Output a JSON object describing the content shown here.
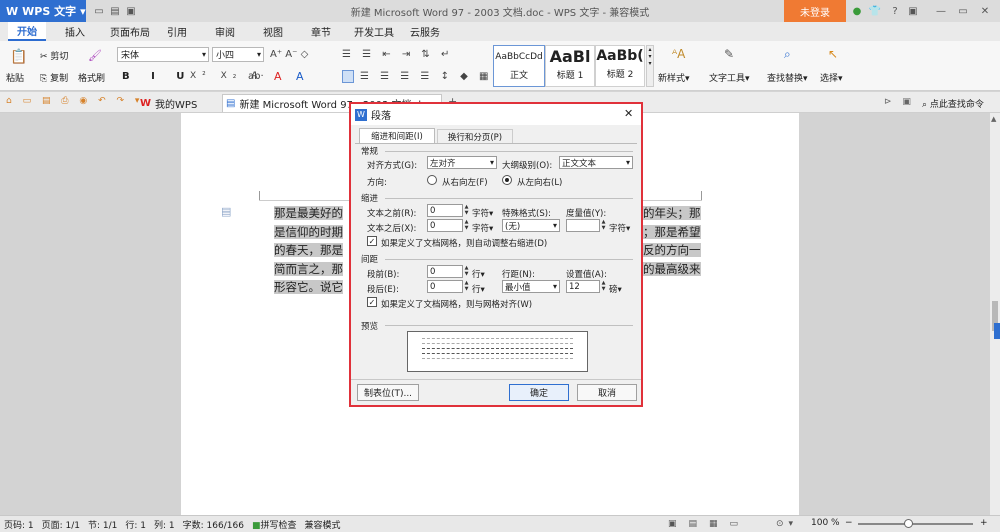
{
  "title_bar": {
    "app_name": "WPS 文字",
    "window_title": "新建 Microsoft Word 97 - 2003 文档.doc - WPS 文字 - 兼容模式",
    "login_label": "未登录"
  },
  "ribbon_tabs": [
    "开始",
    "插入",
    "页面布局",
    "引用",
    "审阅",
    "视图",
    "章节",
    "开发工具",
    "云服务"
  ],
  "ribbon": {
    "paste": "粘贴",
    "cut": "剪切",
    "copy": "复制",
    "format_painter": "格式刷",
    "font_name": "宋体",
    "font_size": "小四",
    "styles": [
      {
        "preview": "AaBbCcDd",
        "label": "正文"
      },
      {
        "preview": "AaBl",
        "label": "标题 1"
      },
      {
        "preview": "AaBb(",
        "label": "标题 2"
      }
    ],
    "new_style": "新样式",
    "text_tools": "文字工具",
    "find_replace": "查找替换",
    "select": "选择"
  },
  "quick_bar": {
    "tabs": [
      "我的WPS",
      "新建 Microsoft Word 97 - 2003 文档.doc"
    ],
    "search_command": "点此查找命令"
  },
  "document": {
    "lines": [
      "那是最美好的",
      "是信仰的时期",
      "的春天，那是",
      "简而言之，那",
      "形容它。说它"
    ],
    "lines_right": [
      "的年头；那",
      "；那是希望",
      "反的方向一",
      "的最高级来"
    ]
  },
  "dialog": {
    "title": "段落",
    "tabs": [
      "缩进和间距(I)",
      "换行和分页(P)"
    ],
    "general": {
      "section": "常规",
      "alignment_label": "对齐方式(G):",
      "alignment_value": "左对齐",
      "outline_label": "大纲级别(O):",
      "outline_value": "正文文本",
      "direction_label": "方向:",
      "rtl_label": "从右向左(F)",
      "ltr_label": "从左向右(L)"
    },
    "indent": {
      "section": "缩进",
      "before_label": "文本之前(R):",
      "before_value": "0",
      "after_label": "文本之后(X):",
      "after_value": "0",
      "unit": "字符",
      "special_label": "特殊格式(S):",
      "special_value": "(无)",
      "measure_label": "度量值(Y):",
      "measure_value": "",
      "measure_unit": "字符",
      "grid_check": "如果定义了文档网格，则自动调整右缩进(D)"
    },
    "spacing": {
      "section": "间距",
      "before_label": "段前(B):",
      "before_value": "0",
      "after_label": "段后(E):",
      "after_value": "0",
      "unit": "行",
      "line_label": "行距(N):",
      "line_value": "最小值",
      "setting_label": "设置值(A):",
      "setting_value": "12",
      "setting_unit": "磅",
      "grid_check": "如果定义了文档网格，则与网格对齐(W)"
    },
    "preview_label": "预览",
    "tabs_button": "制表位(T)...",
    "ok_button": "确定",
    "cancel_button": "取消"
  },
  "status_bar": {
    "page_code": "页码: 1",
    "page": "页面: 1/1",
    "section": "节: 1/1",
    "row": "行: 1",
    "column": "列: 1",
    "word_count": "字数: 166/166",
    "spell_check": "拼写检查",
    "compat_mode": "兼容模式",
    "zoom": "100 %"
  }
}
